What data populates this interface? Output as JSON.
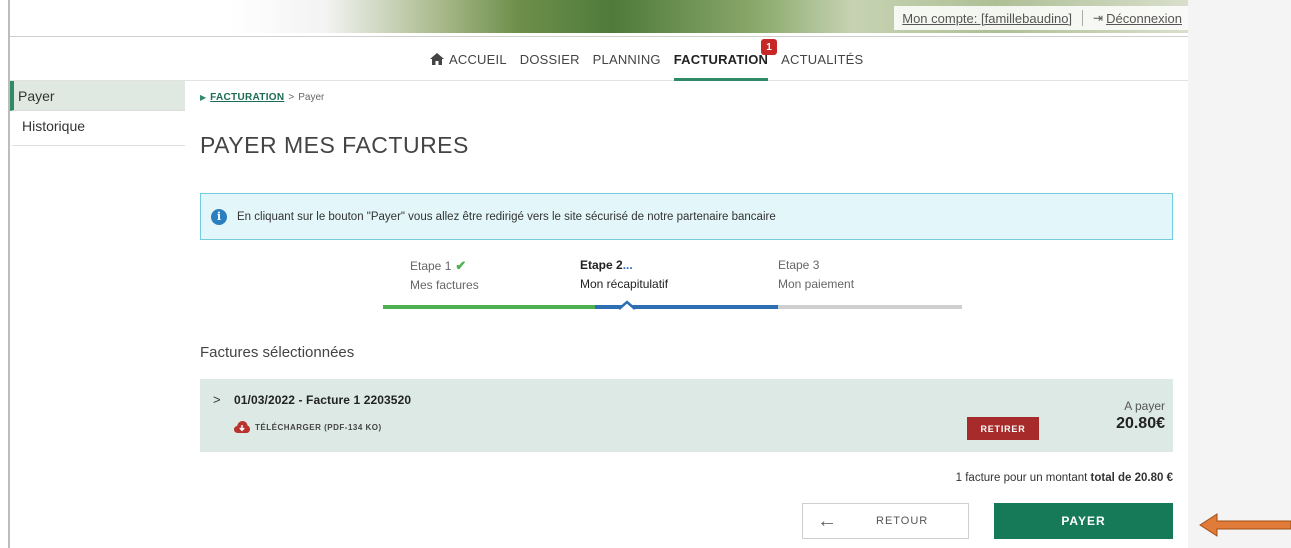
{
  "header": {
    "account_link": "Mon compte: [famillebaudino]",
    "logout_label": "Déconnexion"
  },
  "nav": {
    "items": [
      {
        "label": "ACCUEIL"
      },
      {
        "label": "DOSSIER"
      },
      {
        "label": "PLANNING"
      },
      {
        "label": "FACTURATION",
        "badge": "1"
      },
      {
        "label": "ACTUALITÉS"
      }
    ]
  },
  "sidebar": {
    "items": [
      {
        "label": "Payer"
      },
      {
        "label": "Historique"
      }
    ]
  },
  "breadcrumb": {
    "link": "FACTURATION",
    "separator": ">",
    "current": "Payer"
  },
  "page_title": "PAYER MES FACTURES",
  "info_message": "En cliquant sur le bouton \"Payer\" vous allez être redirigé vers le site sécurisé de notre partenaire bancaire",
  "steps": [
    {
      "title": "Etape 1",
      "subtitle": "Mes factures",
      "state": "done"
    },
    {
      "title": "Etape 2",
      "subtitle": "Mon récapitulatif",
      "state": "current",
      "suffix": "..."
    },
    {
      "title": "Etape 3",
      "subtitle": "Mon paiement",
      "state": "todo"
    }
  ],
  "section_title": "Factures sélectionnées",
  "invoice": {
    "title": "01/03/2022 - Facture 1 2203520",
    "download_label": "TÉLÉCHARGER (PDF-134 KO)",
    "remove_label": "RETIRER",
    "amount_label": "A payer",
    "amount": "20.80€"
  },
  "total": {
    "prefix": "1 facture pour un montant ",
    "bold": "total de 20.80 €"
  },
  "actions": {
    "back_label": "RETOUR",
    "pay_label": "PAYER"
  },
  "colors": {
    "accent_green": "#167a58",
    "remove_red": "#a72b2b",
    "info_bg": "#e3f6f9",
    "pointer_arrow": "#d2691e"
  }
}
